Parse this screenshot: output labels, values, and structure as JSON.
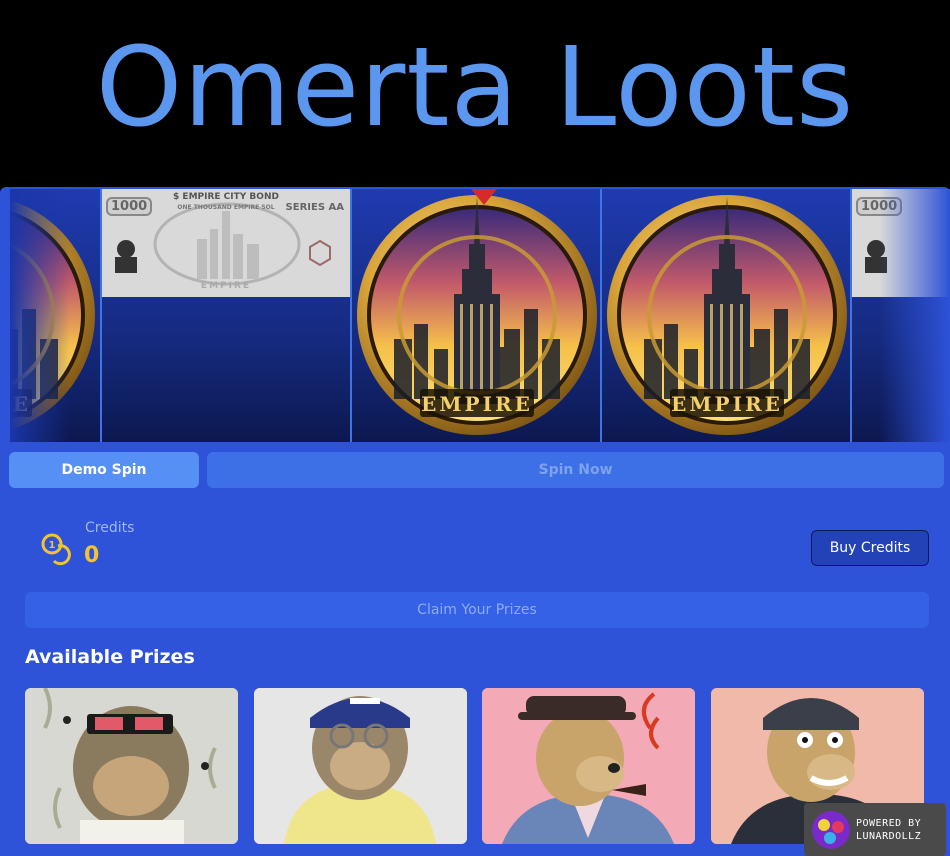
{
  "header": {
    "title": "Omerta Loots"
  },
  "reel": {
    "bond": {
      "heading": "$ EMPIRE CITY BOND",
      "subheading": "ONE THOUSAND EMPIRE SOL",
      "series": "SERIES AA",
      "denomination": "1000",
      "footer": "EMPIRE"
    },
    "coin_label": "EMPIRE"
  },
  "actions": {
    "demo_spin": "Demo Spin",
    "spin_now": "Spin Now"
  },
  "credits": {
    "label": "Credits",
    "value": "0",
    "buy_label": "Buy Credits",
    "claim_label": "Claim Your Prizes"
  },
  "prizes": {
    "title": "Available Prizes",
    "items": [
      {
        "icon": "ape-sunglasses-portrait",
        "bg": "#d8d8d2"
      },
      {
        "icon": "ape-cap-hoodie-portrait",
        "bg": "#e6e6e6"
      },
      {
        "icon": "bear-pipe-hat-portrait",
        "bg": "#f4a9b6"
      },
      {
        "icon": "bear-helmet-jacket-portrait",
        "bg": "#f1b9aa"
      }
    ]
  },
  "badge": {
    "line1": "POWERED BY",
    "line2": "LUNARDOLLZ"
  },
  "colors": {
    "brand_blue": "#5b97ee",
    "panel_blue": "#2e52d8",
    "accent_button": "#5690f5",
    "credits_gold": "#f2c230",
    "pointer_red": "#d72a2a"
  }
}
